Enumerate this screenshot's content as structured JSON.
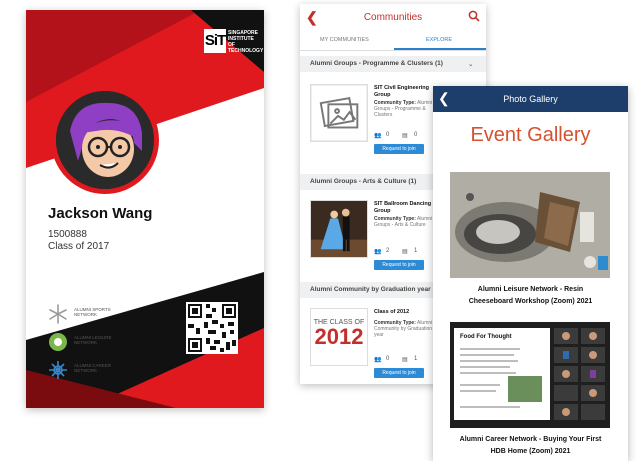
{
  "id_card": {
    "logo_mark": "SiT",
    "logo_text": "SINGAPORE INSTITUTE OF TECHNOLOGY",
    "name": "Jackson Wang",
    "student_id": "1500888",
    "class_of": "Class of 2017",
    "networks": [
      {
        "label": "ALUMNI SPORTS NETWORK",
        "icon": "sports-network-icon",
        "color": "#9a9a9a"
      },
      {
        "label": "ALUMNI LEISURE NETWORK",
        "icon": "leisure-network-icon",
        "color": "#7ab648"
      },
      {
        "label": "ALUMNI CAREER NETWORK",
        "icon": "career-network-icon",
        "color": "#3a86c8"
      }
    ],
    "colors": {
      "red": "#e0191f",
      "dark_red": "#7a0c10",
      "black": "#111111"
    }
  },
  "communities": {
    "title": "Communities",
    "tabs": [
      {
        "label": "MY COMMUNITIES",
        "active": false
      },
      {
        "label": "EXPLORE",
        "active": true
      }
    ],
    "sections": [
      {
        "header": "Alumni Groups - Programme & Clusters (1)",
        "item": {
          "title": "SIT Civil Engineering Group",
          "type_label": "Community Type:",
          "type_value": "Alumni Groups - Programme & Clusters",
          "members": "0",
          "posts": "0",
          "button": "Request to join"
        }
      },
      {
        "header": "Alumni Groups - Arts & Culture (1)",
        "item": {
          "title": "SIT Ballroom Dancing Group",
          "type_label": "Community Type:",
          "type_value": "Alumni Groups - Arts & Culture",
          "members": "2",
          "posts": "1",
          "button": "Request to join"
        }
      },
      {
        "header": "Alumni Community by Graduation year",
        "item": {
          "title": "Class of 2012",
          "type_label": "Community Type:",
          "type_value": "Alumni Community by Graduation year",
          "members": "0",
          "posts": "1",
          "button": "Request to join",
          "thumb_line1": "THE CLASS OF",
          "thumb_line2": "2012"
        }
      }
    ],
    "colors": {
      "accent": "#c3302c",
      "button": "#2d8bd6"
    }
  },
  "gallery": {
    "header_title": "Photo Gallery",
    "title": "Event Gallery",
    "photos": [
      {
        "caption_line1": "Alumni Leisure Network - Resin",
        "caption_line2": "Cheeseboard Workshop (Zoom) 2021"
      },
      {
        "caption_line1": "Alumni Career Network - Buying Your First",
        "caption_line2": "HDB Home (Zoom) 2021",
        "slide_heading": "Food For Thought"
      }
    ],
    "colors": {
      "header": "#1d3d6b",
      "title": "#d6512f"
    }
  }
}
